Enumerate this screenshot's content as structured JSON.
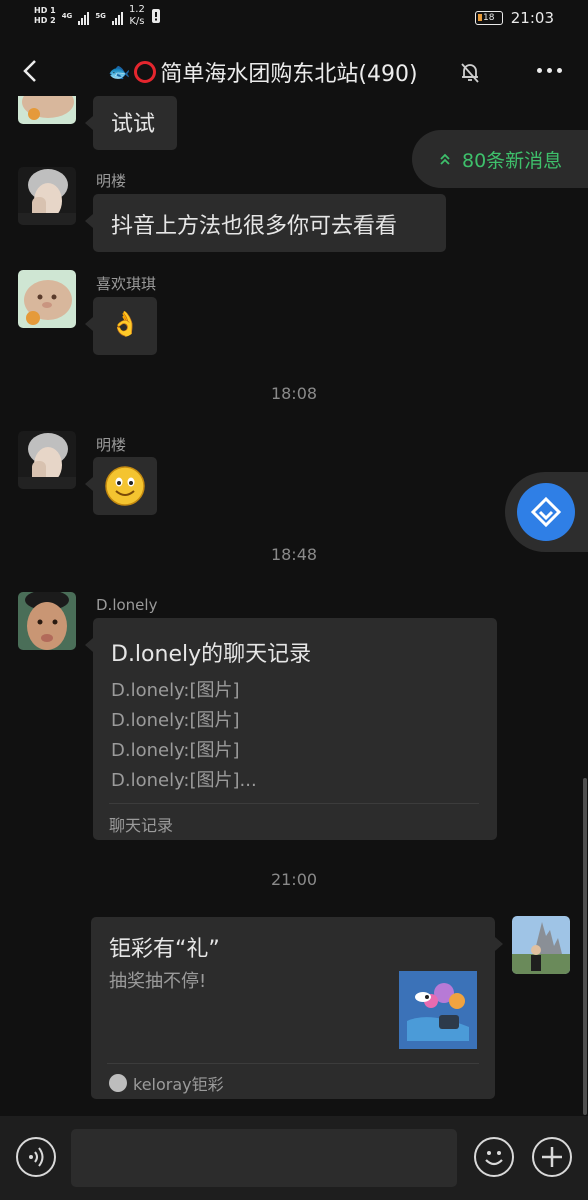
{
  "status_bar": {
    "hd1": "HD 1",
    "hd2": "HD 2",
    "net1": "4G",
    "net2": "5G",
    "speed_value": "1.2",
    "speed_unit": "K/s",
    "battery": "18",
    "time": "21:03"
  },
  "header": {
    "title": "简单海水团购东北站(490)",
    "title_emoji": "🐟"
  },
  "new_messages": {
    "label": "80条新消息"
  },
  "messages": [
    {
      "type": "text",
      "text": "试试"
    },
    {
      "type": "text",
      "sender": "明楼",
      "text": "抖音上方法也很多你可去看看"
    },
    {
      "type": "emoji",
      "sender": "喜欢琪琪",
      "emoji": "👌"
    },
    {
      "type": "time",
      "text": "18:08"
    },
    {
      "type": "emoji",
      "sender": "明楼",
      "emoji": "🙂"
    },
    {
      "type": "time",
      "text": "18:48"
    },
    {
      "type": "chat_record",
      "sender": "D.lonely",
      "title": "D.lonely的聊天记录",
      "lines": [
        "D.lonely:[图片]",
        "D.lonely:[图片]",
        "D.lonely:[图片]",
        "D.lonely:[图片]..."
      ],
      "footer": "聊天记录"
    },
    {
      "type": "time",
      "text": "21:00"
    },
    {
      "type": "link_card",
      "title": "钜彩有“礼”",
      "description": "抽奖抽不停!",
      "source": "keloray钜彩"
    }
  ],
  "colors": {
    "background": "#111111",
    "bubble": "#2c2c2c",
    "new_messages": "#3ec06b",
    "float_button": "#2f7fe6"
  }
}
